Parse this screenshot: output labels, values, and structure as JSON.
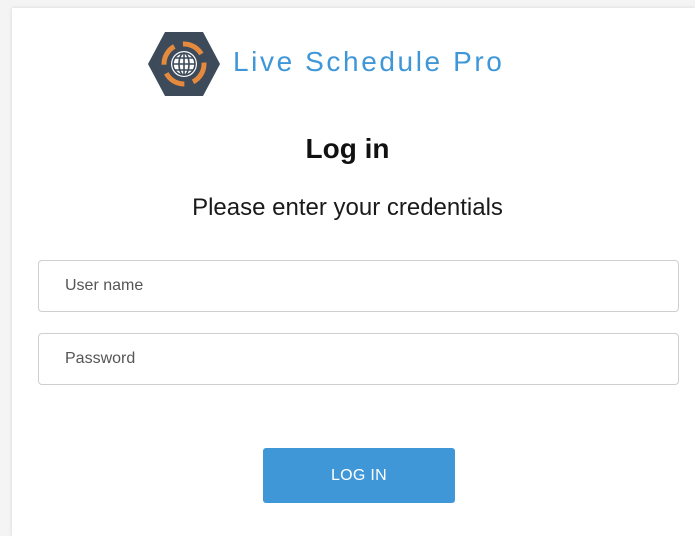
{
  "brand": {
    "name": "Live Schedule Pro",
    "logo_icon": "hexagon-globe-logo-icon",
    "accent_color": "#3f97d8"
  },
  "login": {
    "title": "Log in",
    "subtitle": "Please enter your credentials",
    "username_placeholder": "User name",
    "username_value": "",
    "password_placeholder": "Password",
    "password_value": "",
    "submit_label": "LOG IN"
  }
}
